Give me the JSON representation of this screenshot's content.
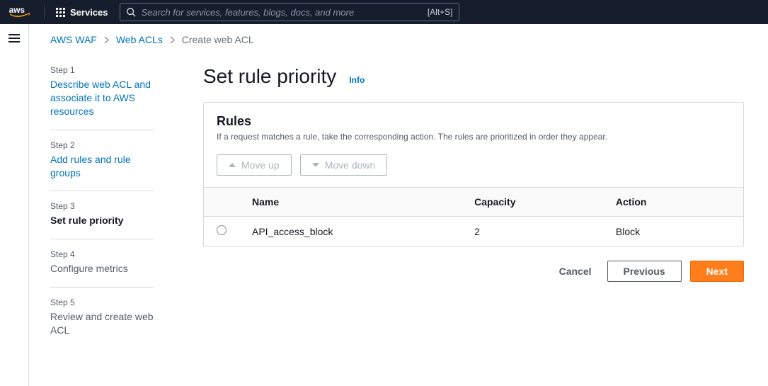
{
  "topnav": {
    "services_label": "Services",
    "search_placeholder": "Search for services, features, blogs, docs, and more",
    "search_hint": "[Alt+S]"
  },
  "breadcrumbs": {
    "items": [
      "AWS WAF",
      "Web ACLs",
      "Create web ACL"
    ]
  },
  "steps": [
    {
      "label": "Step 1",
      "title": "Describe web ACL and associate it to AWS resources",
      "state": "past"
    },
    {
      "label": "Step 2",
      "title": "Add rules and rule groups",
      "state": "past"
    },
    {
      "label": "Step 3",
      "title": "Set rule priority",
      "state": "current"
    },
    {
      "label": "Step 4",
      "title": "Configure metrics",
      "state": "future"
    },
    {
      "label": "Step 5",
      "title": "Review and create web ACL",
      "state": "future"
    }
  ],
  "page": {
    "title": "Set rule priority",
    "info_label": "Info"
  },
  "rules_panel": {
    "title": "Rules",
    "description": "If a request matches a rule, take the corresponding action. The rules are prioritized in order they appear.",
    "move_up_label": "Move up",
    "move_down_label": "Move down",
    "columns": {
      "name": "Name",
      "capacity": "Capacity",
      "action": "Action"
    },
    "rows": [
      {
        "name": "API_access_block",
        "capacity": "2",
        "action": "Block"
      }
    ]
  },
  "footer": {
    "cancel": "Cancel",
    "previous": "Previous",
    "next": "Next"
  }
}
